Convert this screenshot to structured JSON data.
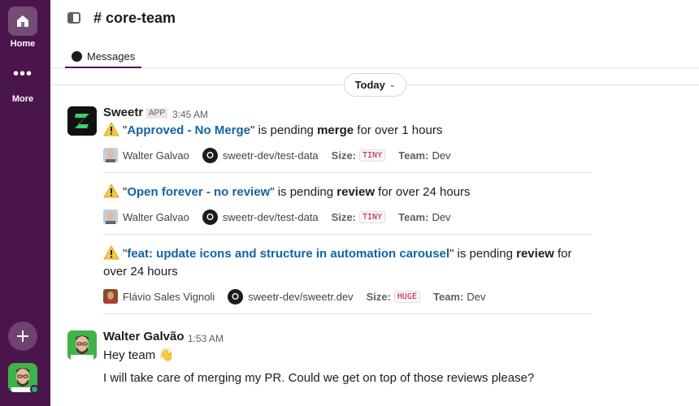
{
  "sidebar": {
    "home_label": "Home",
    "more_label": "More",
    "more_glyph": "•••",
    "icons": {
      "home": "home-icon",
      "more": "ellipsis-icon",
      "add": "plus-icon",
      "avatar": "user-avatar"
    },
    "accent": "#4a154b"
  },
  "header": {
    "channel_name": "# core-team",
    "tab_messages": "Messages"
  },
  "date_divider": {
    "label": "Today",
    "chevron": "⌄"
  },
  "bot_message": {
    "sender": "Sweetr",
    "badge": "APP",
    "time": "3:45 AM",
    "alerts": [
      {
        "quote_open": "\"",
        "pr_title": "Approved - No Merge",
        "quote_close": "\"",
        "text_a": " is pending ",
        "state": "merge",
        "text_b": " for over 1 hours",
        "author": "Walter Galvao",
        "repo": "sweetr-dev/test-data",
        "size_label": "Size:",
        "size": "TINY",
        "team_label": "Team:",
        "team": "Dev"
      },
      {
        "quote_open": "\"",
        "pr_title": "Open forever - no review",
        "quote_close": "\"",
        "text_a": " is pending ",
        "state": "review",
        "text_b": " for over 24 hours",
        "author": "Walter Galvao",
        "repo": "sweetr-dev/test-data",
        "size_label": "Size:",
        "size": "TINY",
        "team_label": "Team:",
        "team": "Dev"
      },
      {
        "quote_open": "\"",
        "pr_title": "feat: update icons and structure in automation carousel",
        "quote_close": "\"",
        "text_a": " is pending ",
        "state": "review",
        "text_b": " for over 24 hours",
        "author": "Flávio Sales Vignoli",
        "repo": "sweetr-dev/sweetr.dev",
        "size_label": "Size:",
        "size": "HUGE",
        "team_label": "Team:",
        "team": "Dev"
      }
    ]
  },
  "user_message": {
    "sender": "Walter Galvão",
    "time": "1:53 AM",
    "line1": "Hey team",
    "wave": "👋",
    "line2": "I will take care of merging my PR. Could we get on top of those reviews please?"
  },
  "colors": {
    "link": "#1264a3",
    "code": "#c01343",
    "warning": "#f2c744"
  }
}
